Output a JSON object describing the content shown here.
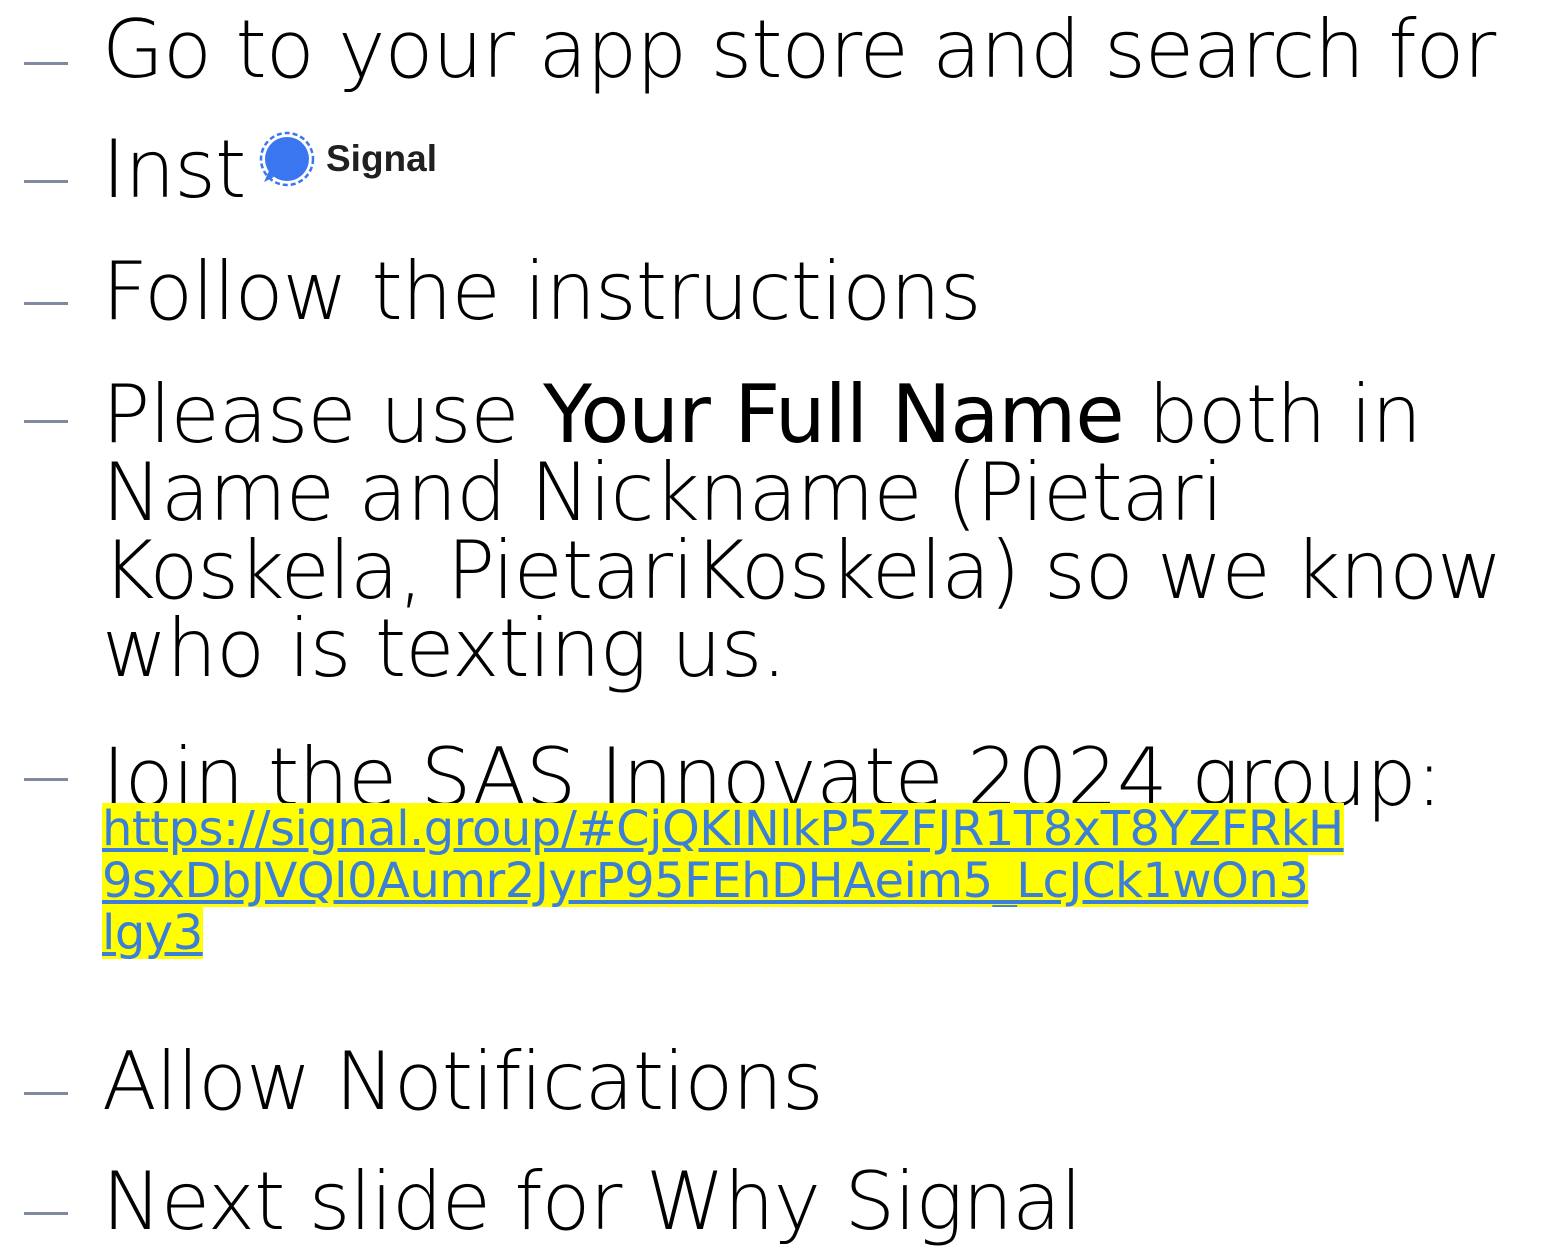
{
  "bullets": [
    {
      "text": "Go to your app store and search for"
    },
    {
      "text": "Inst"
    },
    {
      "text": "Follow the instructions"
    },
    {
      "pre": "Please use ",
      "bold": "Your Full Name",
      "post": " both in Name and Nickname (Pietari Koskela, PietariKoskela) so we know who is texting us."
    },
    {
      "text": "Join the SAS Innovate 2024 group:"
    },
    {
      "text": "Allow Notifications"
    },
    {
      "text": "Next slide for Why Signal"
    }
  ],
  "signal_logo": {
    "label": "Signal",
    "color": "#3a76f0"
  },
  "link": {
    "lines": [
      "https://signal.group/#CjQKINlkP5ZFJR1T8xT8YZFRkH",
      "9sxDbJVQl0Aumr2JyrP95FEhDHAeim5_LcJCk1wOn3",
      "lgy3"
    ],
    "highlight": "#ffff00",
    "color": "#3b7fd9"
  }
}
